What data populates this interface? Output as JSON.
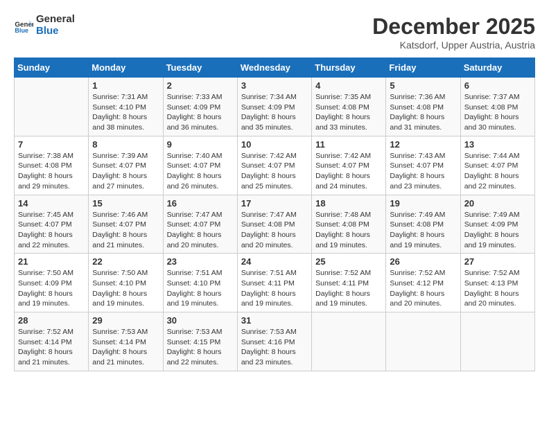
{
  "header": {
    "logo_line1": "General",
    "logo_line2": "Blue",
    "title": "December 2025",
    "location": "Katsdorf, Upper Austria, Austria"
  },
  "days_of_week": [
    "Sunday",
    "Monday",
    "Tuesday",
    "Wednesday",
    "Thursday",
    "Friday",
    "Saturday"
  ],
  "weeks": [
    [
      {
        "day": "",
        "info": ""
      },
      {
        "day": "1",
        "info": "Sunrise: 7:31 AM\nSunset: 4:10 PM\nDaylight: 8 hours\nand 38 minutes."
      },
      {
        "day": "2",
        "info": "Sunrise: 7:33 AM\nSunset: 4:09 PM\nDaylight: 8 hours\nand 36 minutes."
      },
      {
        "day": "3",
        "info": "Sunrise: 7:34 AM\nSunset: 4:09 PM\nDaylight: 8 hours\nand 35 minutes."
      },
      {
        "day": "4",
        "info": "Sunrise: 7:35 AM\nSunset: 4:08 PM\nDaylight: 8 hours\nand 33 minutes."
      },
      {
        "day": "5",
        "info": "Sunrise: 7:36 AM\nSunset: 4:08 PM\nDaylight: 8 hours\nand 31 minutes."
      },
      {
        "day": "6",
        "info": "Sunrise: 7:37 AM\nSunset: 4:08 PM\nDaylight: 8 hours\nand 30 minutes."
      }
    ],
    [
      {
        "day": "7",
        "info": "Sunrise: 7:38 AM\nSunset: 4:08 PM\nDaylight: 8 hours\nand 29 minutes."
      },
      {
        "day": "8",
        "info": "Sunrise: 7:39 AM\nSunset: 4:07 PM\nDaylight: 8 hours\nand 27 minutes."
      },
      {
        "day": "9",
        "info": "Sunrise: 7:40 AM\nSunset: 4:07 PM\nDaylight: 8 hours\nand 26 minutes."
      },
      {
        "day": "10",
        "info": "Sunrise: 7:42 AM\nSunset: 4:07 PM\nDaylight: 8 hours\nand 25 minutes."
      },
      {
        "day": "11",
        "info": "Sunrise: 7:42 AM\nSunset: 4:07 PM\nDaylight: 8 hours\nand 24 minutes."
      },
      {
        "day": "12",
        "info": "Sunrise: 7:43 AM\nSunset: 4:07 PM\nDaylight: 8 hours\nand 23 minutes."
      },
      {
        "day": "13",
        "info": "Sunrise: 7:44 AM\nSunset: 4:07 PM\nDaylight: 8 hours\nand 22 minutes."
      }
    ],
    [
      {
        "day": "14",
        "info": "Sunrise: 7:45 AM\nSunset: 4:07 PM\nDaylight: 8 hours\nand 22 minutes."
      },
      {
        "day": "15",
        "info": "Sunrise: 7:46 AM\nSunset: 4:07 PM\nDaylight: 8 hours\nand 21 minutes."
      },
      {
        "day": "16",
        "info": "Sunrise: 7:47 AM\nSunset: 4:07 PM\nDaylight: 8 hours\nand 20 minutes."
      },
      {
        "day": "17",
        "info": "Sunrise: 7:47 AM\nSunset: 4:08 PM\nDaylight: 8 hours\nand 20 minutes."
      },
      {
        "day": "18",
        "info": "Sunrise: 7:48 AM\nSunset: 4:08 PM\nDaylight: 8 hours\nand 19 minutes."
      },
      {
        "day": "19",
        "info": "Sunrise: 7:49 AM\nSunset: 4:08 PM\nDaylight: 8 hours\nand 19 minutes."
      },
      {
        "day": "20",
        "info": "Sunrise: 7:49 AM\nSunset: 4:09 PM\nDaylight: 8 hours\nand 19 minutes."
      }
    ],
    [
      {
        "day": "21",
        "info": "Sunrise: 7:50 AM\nSunset: 4:09 PM\nDaylight: 8 hours\nand 19 minutes."
      },
      {
        "day": "22",
        "info": "Sunrise: 7:50 AM\nSunset: 4:10 PM\nDaylight: 8 hours\nand 19 minutes."
      },
      {
        "day": "23",
        "info": "Sunrise: 7:51 AM\nSunset: 4:10 PM\nDaylight: 8 hours\nand 19 minutes."
      },
      {
        "day": "24",
        "info": "Sunrise: 7:51 AM\nSunset: 4:11 PM\nDaylight: 8 hours\nand 19 minutes."
      },
      {
        "day": "25",
        "info": "Sunrise: 7:52 AM\nSunset: 4:11 PM\nDaylight: 8 hours\nand 19 minutes."
      },
      {
        "day": "26",
        "info": "Sunrise: 7:52 AM\nSunset: 4:12 PM\nDaylight: 8 hours\nand 20 minutes."
      },
      {
        "day": "27",
        "info": "Sunrise: 7:52 AM\nSunset: 4:13 PM\nDaylight: 8 hours\nand 20 minutes."
      }
    ],
    [
      {
        "day": "28",
        "info": "Sunrise: 7:52 AM\nSunset: 4:14 PM\nDaylight: 8 hours\nand 21 minutes."
      },
      {
        "day": "29",
        "info": "Sunrise: 7:53 AM\nSunset: 4:14 PM\nDaylight: 8 hours\nand 21 minutes."
      },
      {
        "day": "30",
        "info": "Sunrise: 7:53 AM\nSunset: 4:15 PM\nDaylight: 8 hours\nand 22 minutes."
      },
      {
        "day": "31",
        "info": "Sunrise: 7:53 AM\nSunset: 4:16 PM\nDaylight: 8 hours\nand 23 minutes."
      },
      {
        "day": "",
        "info": ""
      },
      {
        "day": "",
        "info": ""
      },
      {
        "day": "",
        "info": ""
      }
    ]
  ]
}
